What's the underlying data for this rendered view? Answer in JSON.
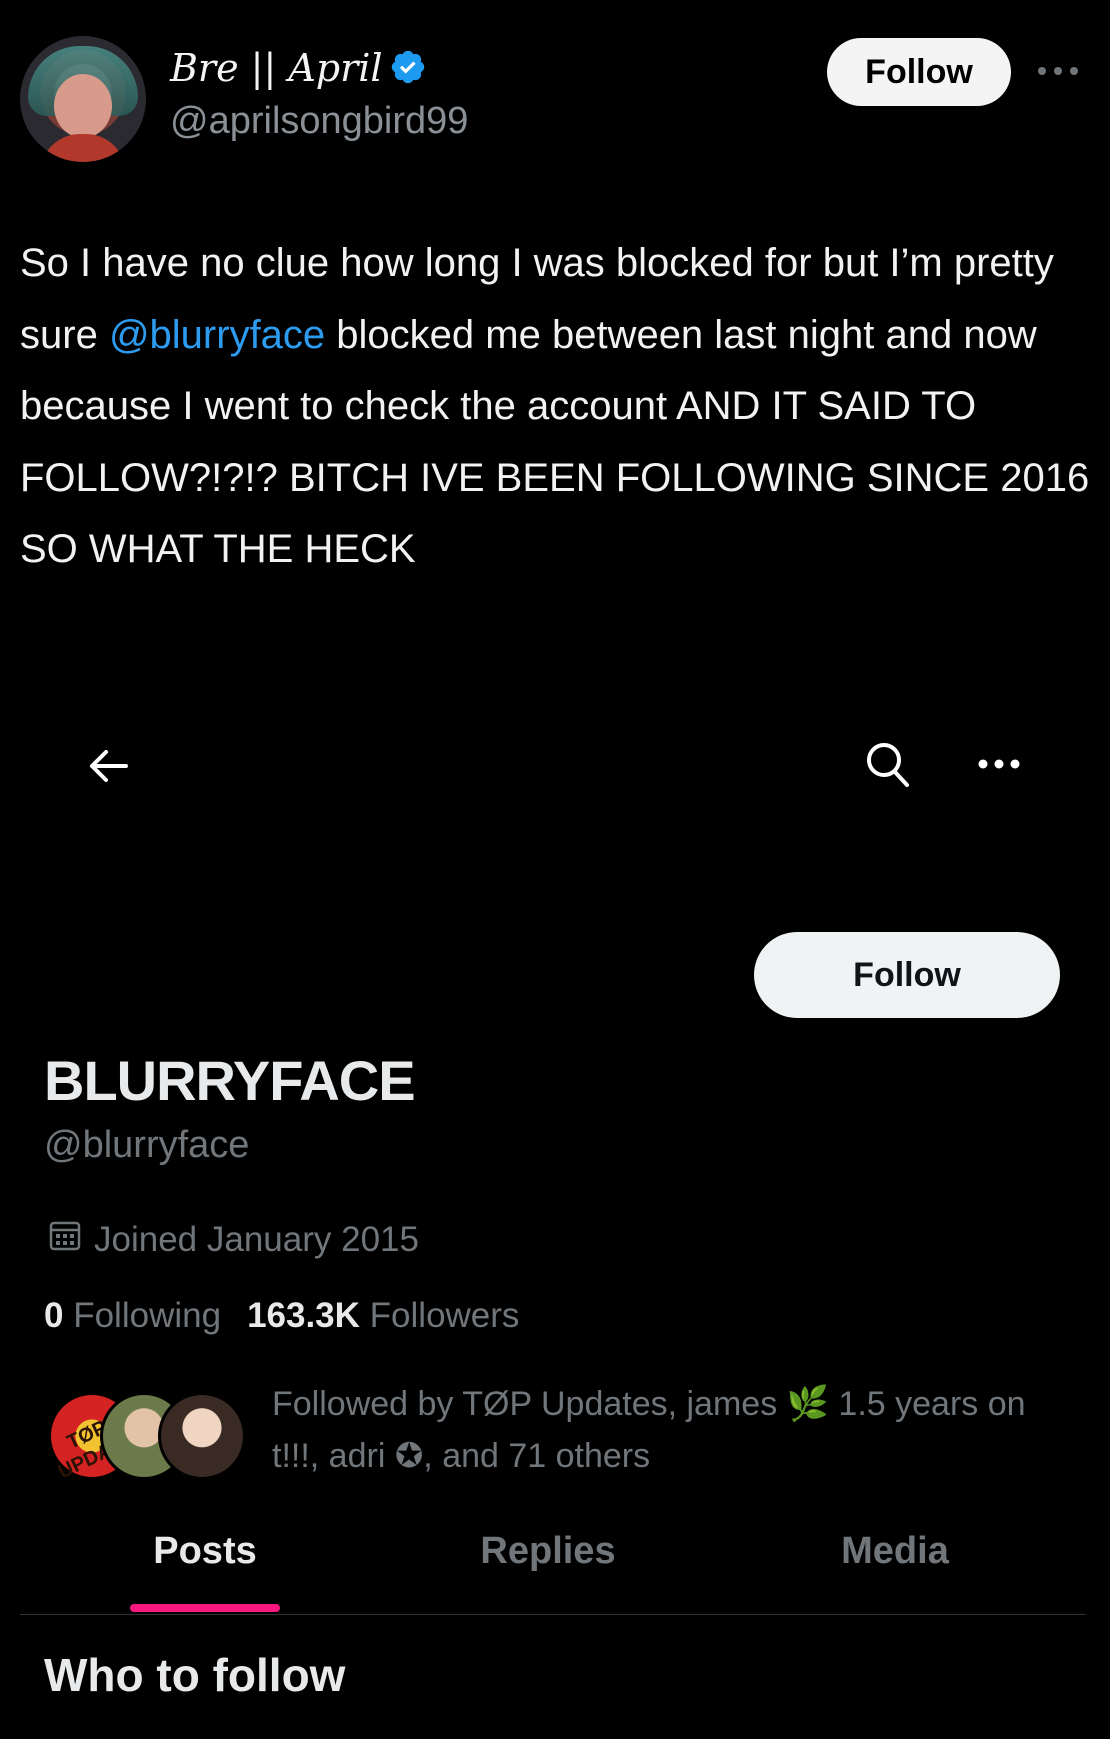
{
  "tweet": {
    "author": {
      "display_name": "Bre || April",
      "handle": "@aprilsongbird99",
      "verified": true
    },
    "follow_label": "Follow",
    "text_segments": [
      "So I have no clue how long I was blocked for but I’m pretty sure ",
      "@blurryface",
      " blocked me between last night and now because I went to check the account AND IT SAID TO FOLLOW?!?!? BITCH IVE BEEN FOLLOWING SINCE 2016 SO WHAT THE HECK"
    ]
  },
  "profile": {
    "follow_label": "Follow",
    "name": "BLURRYFACE",
    "handle": "@blurryface",
    "joined": "Joined January 2015",
    "following_count": "0",
    "following_label": "Following",
    "followers_count": "163.3K",
    "followers_label": "Followers",
    "followed_by": "Followed by TØP Updates, james 🌿 1.5 years on t!!!, adri ✪, and 71 others",
    "follower_avatar_1_text": "TØP UPDATES",
    "tabs": [
      {
        "label": "Posts",
        "active": true
      },
      {
        "label": "Replies",
        "active": false
      },
      {
        "label": "Media",
        "active": false
      }
    ],
    "section_title": "Who to follow"
  },
  "icons": {
    "verified": "verified-badge-icon",
    "more": "more-horizontal-icon",
    "back": "back-arrow-icon",
    "search": "search-icon",
    "calendar": "calendar-icon"
  },
  "colors": {
    "background": "#000000",
    "link": "#2d9bf0",
    "verified": "#1d9bf0",
    "muted": "#71767b",
    "tab_indicator": "#f91880",
    "button": "#eff3f4"
  }
}
